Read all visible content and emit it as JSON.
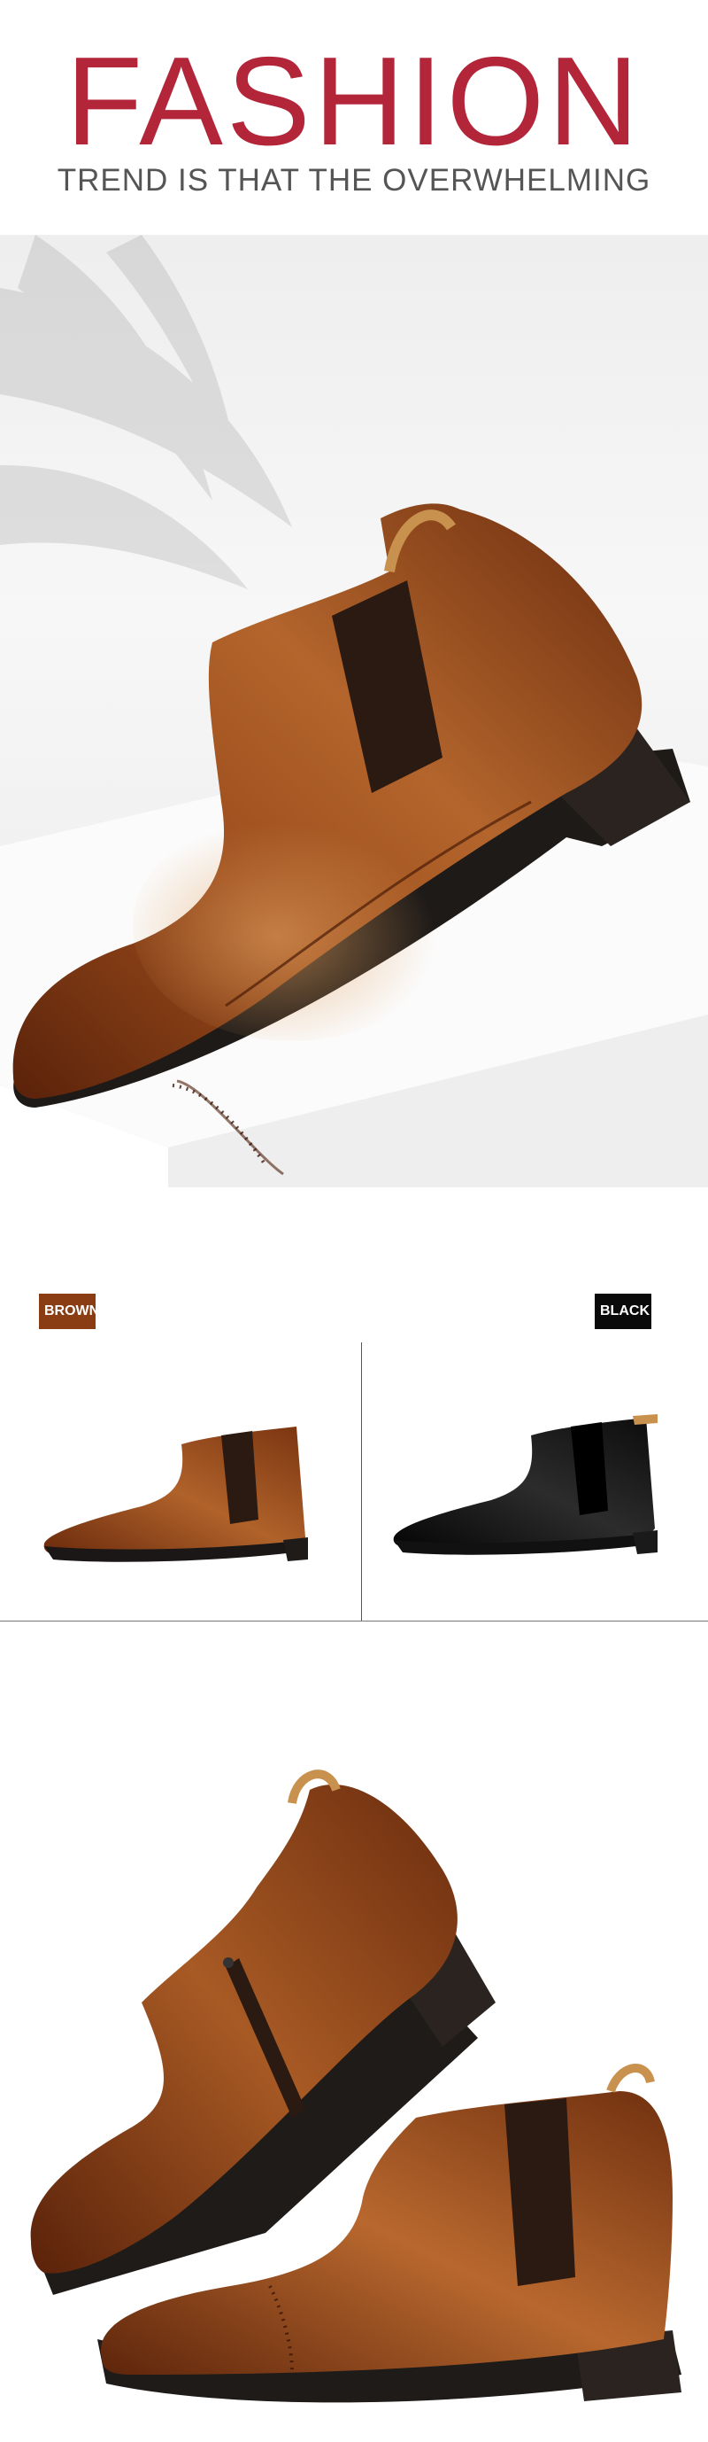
{
  "header": {
    "title": "FASHION",
    "subtitle": "TREND IS THAT THE OVERWHELMING"
  },
  "colors_section": {
    "brown_label": "BROWN",
    "black_label": "BLACK"
  },
  "palette": {
    "title_red": "#b3263a",
    "leather_brown": "#8a3c12",
    "black": "#0a0a0a"
  }
}
